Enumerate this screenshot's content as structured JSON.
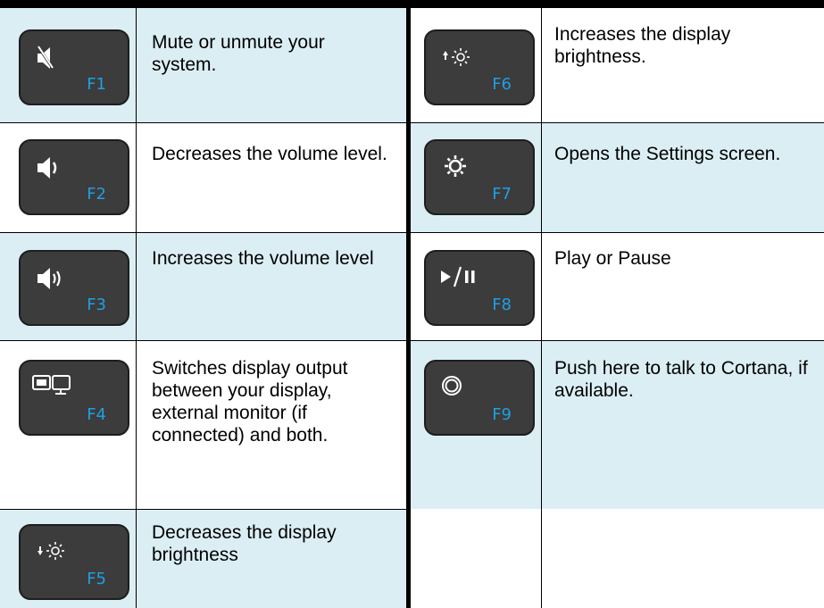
{
  "keys": [
    {
      "f": "F1",
      "icon": "mute-icon",
      "desc": "Mute or unmute your system."
    },
    {
      "f": "F2",
      "icon": "volume-down-icon",
      "desc": "Decreases the volume level."
    },
    {
      "f": "F3",
      "icon": "volume-up-icon",
      "desc": "Increases the volume level"
    },
    {
      "f": "F4",
      "icon": "display-switch-icon",
      "desc": "Switches display output between your display, external monitor (if connected) and both."
    },
    {
      "f": "F5",
      "icon": "brightness-down-icon",
      "desc": "Decreases the display brightness"
    },
    {
      "f": "F6",
      "icon": "brightness-up-icon",
      "desc": "Increases the display brightness."
    },
    {
      "f": "F7",
      "icon": "settings-gear-icon",
      "desc": "Opens the Settings screen."
    },
    {
      "f": "F8",
      "icon": "play-pause-icon",
      "desc": "Play or Pause"
    },
    {
      "f": "F9",
      "icon": "cortana-icon",
      "desc": "Push here to talk to Cortana, if available."
    }
  ],
  "colors": {
    "shade": "#dbeef4",
    "key_bg": "#3c3c3c",
    "f_label": "#1f9fe5",
    "glyph": "#ffffff"
  }
}
